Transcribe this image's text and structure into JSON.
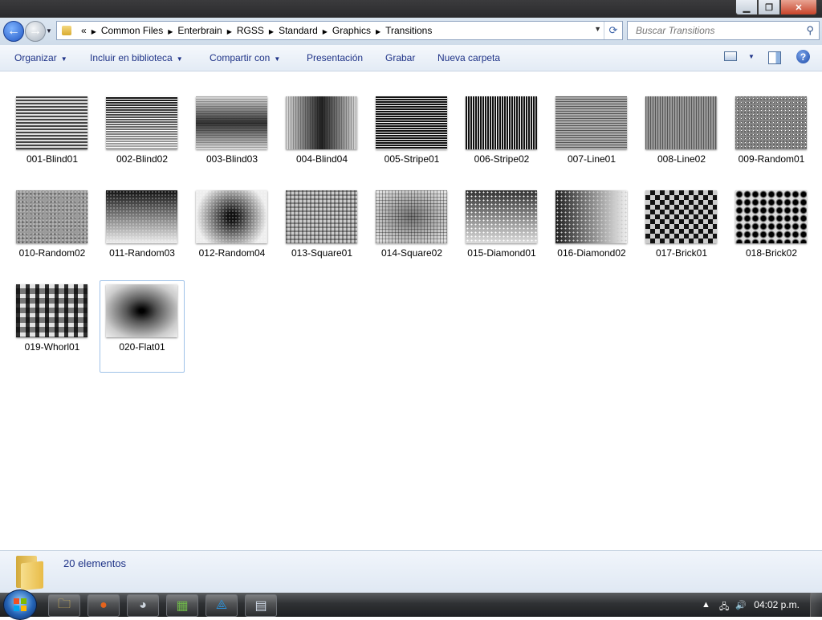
{
  "address": {
    "crumbs": [
      "Common Files",
      "Enterbrain",
      "RGSS",
      "Standard",
      "Graphics",
      "Transitions"
    ],
    "overflow_glyph": "«"
  },
  "search": {
    "placeholder": "Buscar Transitions"
  },
  "toolbar": {
    "organizar": "Organizar",
    "biblioteca": "Incluir en biblioteca",
    "compartir": "Compartir con",
    "presentacion": "Presentación",
    "grabar": "Grabar",
    "nueva_carpeta": "Nueva carpeta",
    "help_glyph": "?"
  },
  "files": [
    {
      "name": "001-Blind01",
      "pattern": "blind01"
    },
    {
      "name": "002-Blind02",
      "pattern": "blind02"
    },
    {
      "name": "003-Blind03",
      "pattern": "blind03"
    },
    {
      "name": "004-Blind04",
      "pattern": "blind04"
    },
    {
      "name": "005-Stripe01",
      "pattern": "stripe01"
    },
    {
      "name": "006-Stripe02",
      "pattern": "stripe02"
    },
    {
      "name": "007-Line01",
      "pattern": "line01"
    },
    {
      "name": "008-Line02",
      "pattern": "line02"
    },
    {
      "name": "009-Random01",
      "pattern": "random01"
    },
    {
      "name": "010-Random02",
      "pattern": "random02"
    },
    {
      "name": "011-Random03",
      "pattern": "random03"
    },
    {
      "name": "012-Random04",
      "pattern": "random04"
    },
    {
      "name": "013-Square01",
      "pattern": "square01"
    },
    {
      "name": "014-Square02",
      "pattern": "square02"
    },
    {
      "name": "015-Diamond01",
      "pattern": "diamond01"
    },
    {
      "name": "016-Diamond02",
      "pattern": "diamond02"
    },
    {
      "name": "017-Brick01",
      "pattern": "brick01"
    },
    {
      "name": "018-Brick02",
      "pattern": "brick02"
    },
    {
      "name": "019-Whorl01",
      "pattern": "whorl01"
    },
    {
      "name": "020-Flat01",
      "pattern": "flat01",
      "selected": true
    }
  ],
  "details": {
    "item_count": "20 elementos"
  },
  "taskbar": {
    "clock": "04:02 p.m.",
    "apps": [
      "explorer-icon",
      "firefox-icon",
      "messenger-icon",
      "photo-gallery-icon",
      "arduino-icon",
      "document-icon"
    ]
  }
}
